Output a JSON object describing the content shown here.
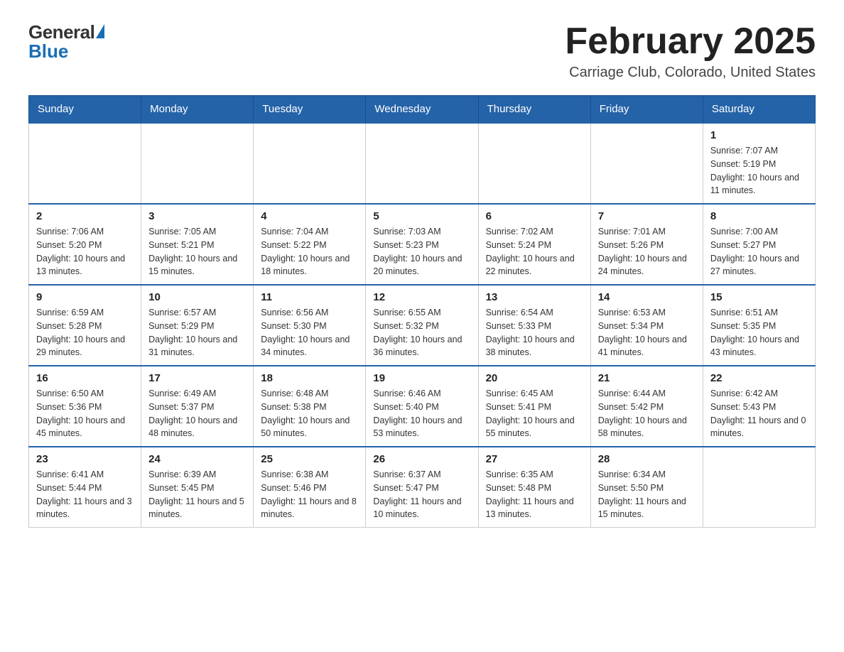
{
  "header": {
    "logo_general": "General",
    "logo_blue": "Blue",
    "month_title": "February 2025",
    "location": "Carriage Club, Colorado, United States"
  },
  "days_of_week": [
    "Sunday",
    "Monday",
    "Tuesday",
    "Wednesday",
    "Thursday",
    "Friday",
    "Saturday"
  ],
  "weeks": [
    [
      {
        "day": "",
        "info": ""
      },
      {
        "day": "",
        "info": ""
      },
      {
        "day": "",
        "info": ""
      },
      {
        "day": "",
        "info": ""
      },
      {
        "day": "",
        "info": ""
      },
      {
        "day": "",
        "info": ""
      },
      {
        "day": "1",
        "info": "Sunrise: 7:07 AM\nSunset: 5:19 PM\nDaylight: 10 hours and 11 minutes."
      }
    ],
    [
      {
        "day": "2",
        "info": "Sunrise: 7:06 AM\nSunset: 5:20 PM\nDaylight: 10 hours and 13 minutes."
      },
      {
        "day": "3",
        "info": "Sunrise: 7:05 AM\nSunset: 5:21 PM\nDaylight: 10 hours and 15 minutes."
      },
      {
        "day": "4",
        "info": "Sunrise: 7:04 AM\nSunset: 5:22 PM\nDaylight: 10 hours and 18 minutes."
      },
      {
        "day": "5",
        "info": "Sunrise: 7:03 AM\nSunset: 5:23 PM\nDaylight: 10 hours and 20 minutes."
      },
      {
        "day": "6",
        "info": "Sunrise: 7:02 AM\nSunset: 5:24 PM\nDaylight: 10 hours and 22 minutes."
      },
      {
        "day": "7",
        "info": "Sunrise: 7:01 AM\nSunset: 5:26 PM\nDaylight: 10 hours and 24 minutes."
      },
      {
        "day": "8",
        "info": "Sunrise: 7:00 AM\nSunset: 5:27 PM\nDaylight: 10 hours and 27 minutes."
      }
    ],
    [
      {
        "day": "9",
        "info": "Sunrise: 6:59 AM\nSunset: 5:28 PM\nDaylight: 10 hours and 29 minutes."
      },
      {
        "day": "10",
        "info": "Sunrise: 6:57 AM\nSunset: 5:29 PM\nDaylight: 10 hours and 31 minutes."
      },
      {
        "day": "11",
        "info": "Sunrise: 6:56 AM\nSunset: 5:30 PM\nDaylight: 10 hours and 34 minutes."
      },
      {
        "day": "12",
        "info": "Sunrise: 6:55 AM\nSunset: 5:32 PM\nDaylight: 10 hours and 36 minutes."
      },
      {
        "day": "13",
        "info": "Sunrise: 6:54 AM\nSunset: 5:33 PM\nDaylight: 10 hours and 38 minutes."
      },
      {
        "day": "14",
        "info": "Sunrise: 6:53 AM\nSunset: 5:34 PM\nDaylight: 10 hours and 41 minutes."
      },
      {
        "day": "15",
        "info": "Sunrise: 6:51 AM\nSunset: 5:35 PM\nDaylight: 10 hours and 43 minutes."
      }
    ],
    [
      {
        "day": "16",
        "info": "Sunrise: 6:50 AM\nSunset: 5:36 PM\nDaylight: 10 hours and 45 minutes."
      },
      {
        "day": "17",
        "info": "Sunrise: 6:49 AM\nSunset: 5:37 PM\nDaylight: 10 hours and 48 minutes."
      },
      {
        "day": "18",
        "info": "Sunrise: 6:48 AM\nSunset: 5:38 PM\nDaylight: 10 hours and 50 minutes."
      },
      {
        "day": "19",
        "info": "Sunrise: 6:46 AM\nSunset: 5:40 PM\nDaylight: 10 hours and 53 minutes."
      },
      {
        "day": "20",
        "info": "Sunrise: 6:45 AM\nSunset: 5:41 PM\nDaylight: 10 hours and 55 minutes."
      },
      {
        "day": "21",
        "info": "Sunrise: 6:44 AM\nSunset: 5:42 PM\nDaylight: 10 hours and 58 minutes."
      },
      {
        "day": "22",
        "info": "Sunrise: 6:42 AM\nSunset: 5:43 PM\nDaylight: 11 hours and 0 minutes."
      }
    ],
    [
      {
        "day": "23",
        "info": "Sunrise: 6:41 AM\nSunset: 5:44 PM\nDaylight: 11 hours and 3 minutes."
      },
      {
        "day": "24",
        "info": "Sunrise: 6:39 AM\nSunset: 5:45 PM\nDaylight: 11 hours and 5 minutes."
      },
      {
        "day": "25",
        "info": "Sunrise: 6:38 AM\nSunset: 5:46 PM\nDaylight: 11 hours and 8 minutes."
      },
      {
        "day": "26",
        "info": "Sunrise: 6:37 AM\nSunset: 5:47 PM\nDaylight: 11 hours and 10 minutes."
      },
      {
        "day": "27",
        "info": "Sunrise: 6:35 AM\nSunset: 5:48 PM\nDaylight: 11 hours and 13 minutes."
      },
      {
        "day": "28",
        "info": "Sunrise: 6:34 AM\nSunset: 5:50 PM\nDaylight: 11 hours and 15 minutes."
      },
      {
        "day": "",
        "info": ""
      }
    ]
  ]
}
